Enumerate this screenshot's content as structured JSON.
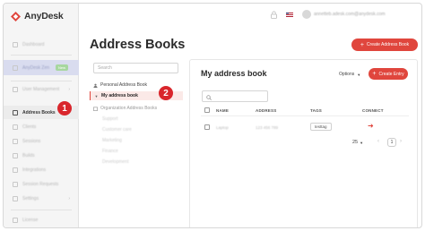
{
  "brand": {
    "name": "AnyDesk",
    "accent": "#e0463d"
  },
  "topbar": {
    "user_email": "annetteb.adesk.com@anydesk.com",
    "icons": [
      "lock-icon",
      "us-flag-icon",
      "avatar"
    ]
  },
  "sidebar": {
    "items": [
      {
        "label": "Dashboard"
      },
      {
        "label": "AnyDesk Zen",
        "badge": "New"
      },
      {
        "label": "User Management"
      },
      {
        "label": "Address Books"
      },
      {
        "label": "Clients"
      },
      {
        "label": "Sessions"
      },
      {
        "label": "Builds"
      },
      {
        "label": "Integrations"
      },
      {
        "label": "Session Requests"
      },
      {
        "label": "Settings"
      },
      {
        "label": "License"
      }
    ]
  },
  "markers": {
    "one": "1",
    "two": "2"
  },
  "page": {
    "title": "Address Books",
    "create_button": "Create Address Book"
  },
  "tree": {
    "search_placeholder": "Search",
    "personal": "Personal Address Book",
    "my_book": "My address book",
    "organization": "Organization Address Books",
    "org_children": [
      "Support",
      "Customer care",
      "Marketing",
      "Finance",
      "Development"
    ]
  },
  "content": {
    "title": "My address book",
    "options_label": "Options",
    "create_entry": "Create Entry",
    "columns": {
      "name": "NAME",
      "address": "ADDRESS",
      "tags": "TAGS",
      "connect": "CONNECT"
    },
    "row": {
      "name": "Laptop",
      "address": "123 456 789",
      "tag": "testtag"
    },
    "per_page": "25",
    "page": "1"
  }
}
